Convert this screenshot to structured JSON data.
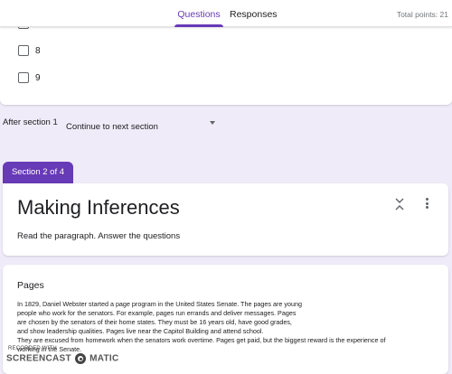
{
  "header": {
    "tabs": [
      {
        "label": "Questions",
        "active": true
      },
      {
        "label": "Responses",
        "active": false
      }
    ],
    "total_points": "Total points: 21"
  },
  "question_options": {
    "items": [
      {
        "label": "8"
      },
      {
        "label": "9"
      }
    ]
  },
  "after_section": {
    "label": "After section 1",
    "selected": "Continue to next section"
  },
  "section": {
    "tab_label": "Section 2 of 4",
    "title": "Making Inferences",
    "description": "Read the paragraph. Answer the questions"
  },
  "pages": {
    "title": "Pages",
    "lines": [
      "In 1829, Daniel Webster started a page program in the United States Senate. The pages are young",
      "people who work for the senators. For example, pages run errands and deliver messages. Pages",
      "are chosen by the senators of their home states. They must be 16 years old, have good grades,",
      "and show leadership qualities. Pages live near the Capitol Building and attend school.",
      "They are excused from homework when the senators work overtime. Pages get paid, but the biggest reward is the experience of",
      "working in the Senate."
    ]
  },
  "watermark": {
    "top_text": "RECORDED WITH",
    "left_text": "SCREENCAST",
    "right_text": "MATIC"
  },
  "colors": {
    "accent": "#673ab7",
    "background": "#f0ebf8"
  }
}
